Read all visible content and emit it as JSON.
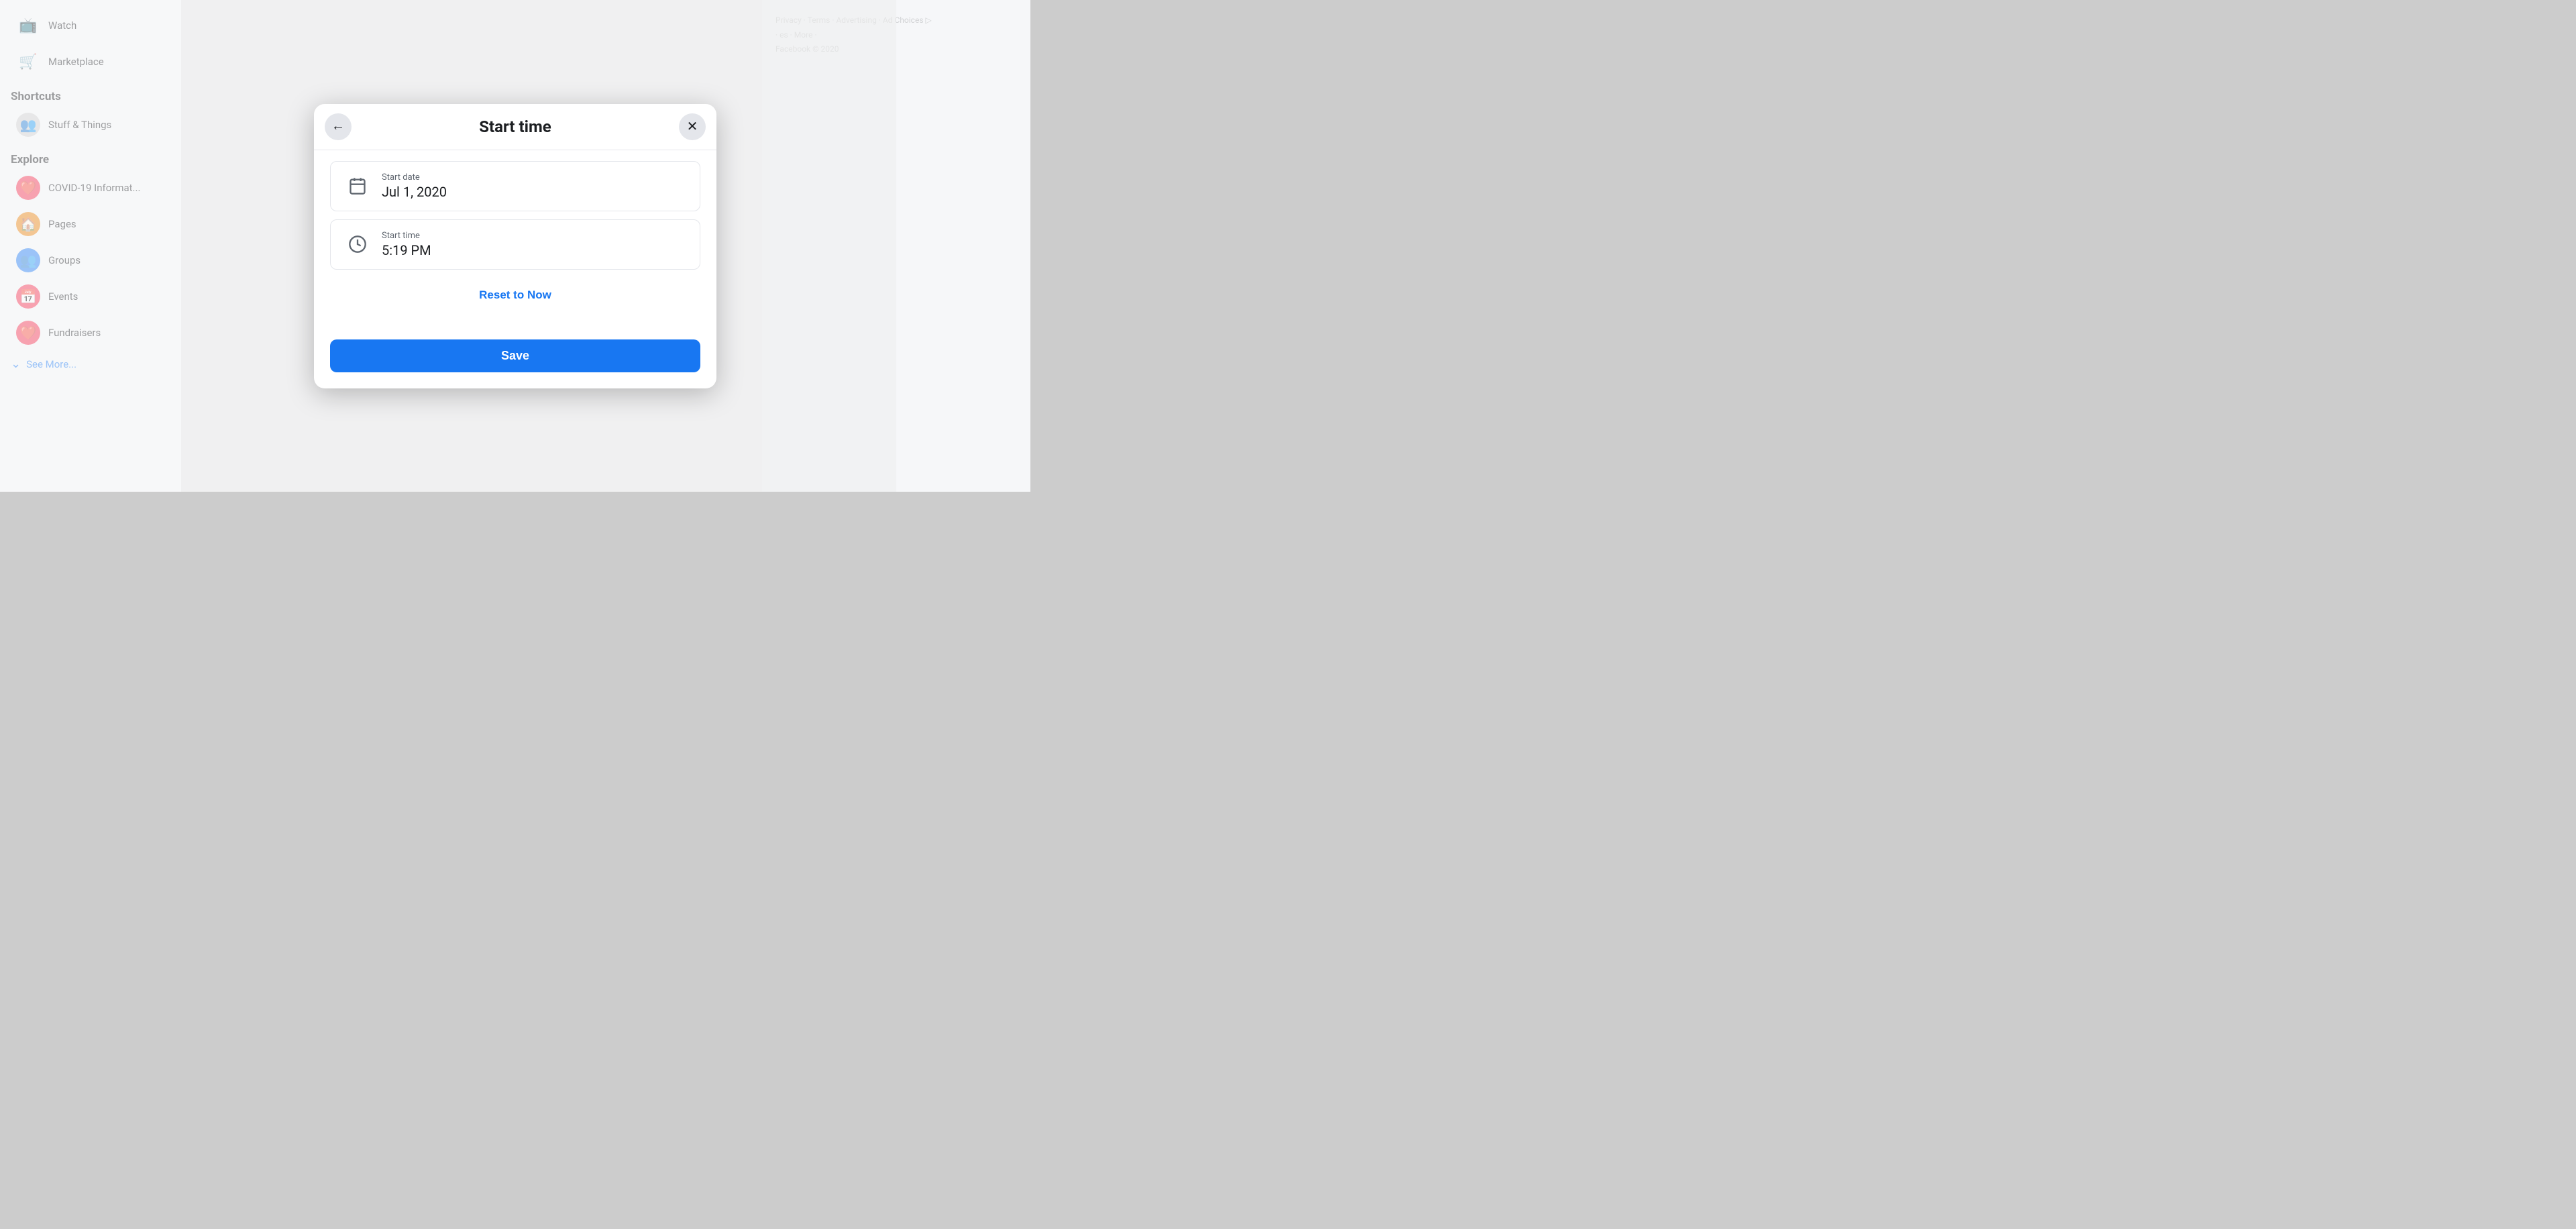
{
  "sidebar": {
    "items": [
      {
        "id": "watch",
        "label": "Watch",
        "icon": "📺"
      },
      {
        "id": "marketplace",
        "label": "Marketplace",
        "icon": "🛒"
      }
    ],
    "shortcuts_title": "Shortcuts",
    "shortcuts": [
      {
        "id": "stuff-things",
        "label": "Stuff & Things",
        "icon": "👥"
      }
    ],
    "explore_title": "Explore",
    "explore": [
      {
        "id": "covid",
        "label": "COVID-19 Informat...",
        "icon": "❤️"
      },
      {
        "id": "pages",
        "label": "Pages",
        "icon": "🏠"
      },
      {
        "id": "groups",
        "label": "Groups",
        "icon": "👥"
      },
      {
        "id": "events",
        "label": "Events",
        "icon": "📅"
      },
      {
        "id": "fundraisers",
        "label": "Fundraisers",
        "icon": "❤️"
      }
    ],
    "see_more": "See More..."
  },
  "footer": {
    "links": [
      "Privacy",
      "Terms",
      "Advertising",
      "Ad Choices ▷"
    ],
    "more": "More ·",
    "copyright": "Facebook © 2020"
  },
  "modal": {
    "title": "Start time",
    "back_label": "←",
    "close_label": "✕",
    "start_date_label": "Start date",
    "start_date_value": "Jul 1, 2020",
    "start_time_label": "Start time",
    "start_time_value": "5:19 PM",
    "reset_label": "Reset to Now",
    "save_label": "Save"
  }
}
